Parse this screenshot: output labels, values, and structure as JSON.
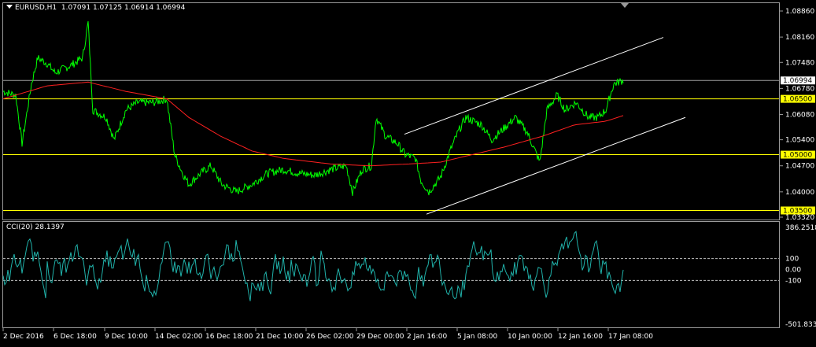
{
  "header": {
    "symbol": "EURUSD,H1",
    "ohlc": "1.07091 1.07125 1.06914 1.06994"
  },
  "cci_header": {
    "label": "CCI(20) 28.1397"
  },
  "price_scale": [
    "1.08860",
    "1.08160",
    "1.07480",
    "1.06780",
    "1.06080",
    "1.05400",
    "1.04700",
    "1.04000",
    "1.03320"
  ],
  "current_price": "1.06994",
  "levels": [
    "1.06500",
    "1.05000",
    "1.03500"
  ],
  "cci_scale": [
    "386.2518",
    "100",
    "0.00",
    "-100",
    "-501.8330"
  ],
  "time_scale": [
    "2 Dec 2016",
    "6 Dec 18:00",
    "9 Dec 10:00",
    "14 Dec 02:00",
    "16 Dec 18:00",
    "21 Dec 10:00",
    "26 Dec 02:00",
    "29 Dec 00:00",
    "2 Jan 16:00",
    "5 Jan 08:00",
    "10 Jan 00:00",
    "12 Jan 16:00",
    "17 Jan 08:00"
  ],
  "colors": {
    "background": "#000000",
    "price_line": "#00ff00",
    "moving_average": "#ff2020",
    "levels": "#ffff00",
    "channel": "#ffffff",
    "cci_line": "#20b2aa",
    "grid": "#9a9a9a"
  }
}
